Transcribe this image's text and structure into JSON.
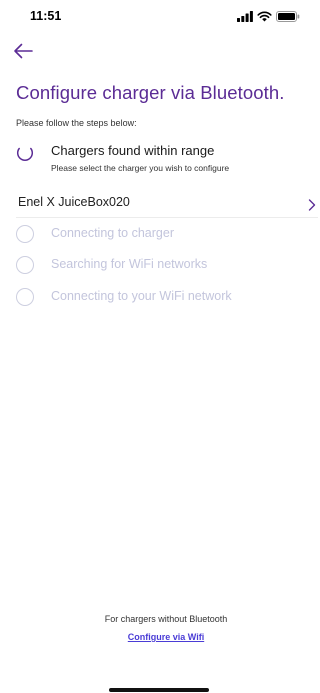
{
  "status_bar": {
    "time": "11:51",
    "icons": [
      "signal-icon",
      "wifi-icon",
      "battery-icon"
    ]
  },
  "header": {
    "back_icon": "arrow-left-icon",
    "title": "Configure charger via Bluetooth."
  },
  "instructions": "Please follow the steps below:",
  "active_step": {
    "label": "Chargers found within range",
    "sublabel": "Please select the charger you wish to configure"
  },
  "chargers": [
    {
      "name": "Enel X JuiceBox020",
      "icon": "chevron-right-icon"
    }
  ],
  "pending_steps": [
    {
      "label": "Connecting to charger"
    },
    {
      "label": "Searching for WiFi networks"
    },
    {
      "label": "Connecting to your WiFi network"
    }
  ],
  "footer": {
    "note": "For chargers without Bluetooth",
    "link": "Configure via Wifi"
  },
  "colors": {
    "accent": "#5b2c95",
    "link": "#4a3cd6",
    "pending": "#c3c5dc"
  }
}
